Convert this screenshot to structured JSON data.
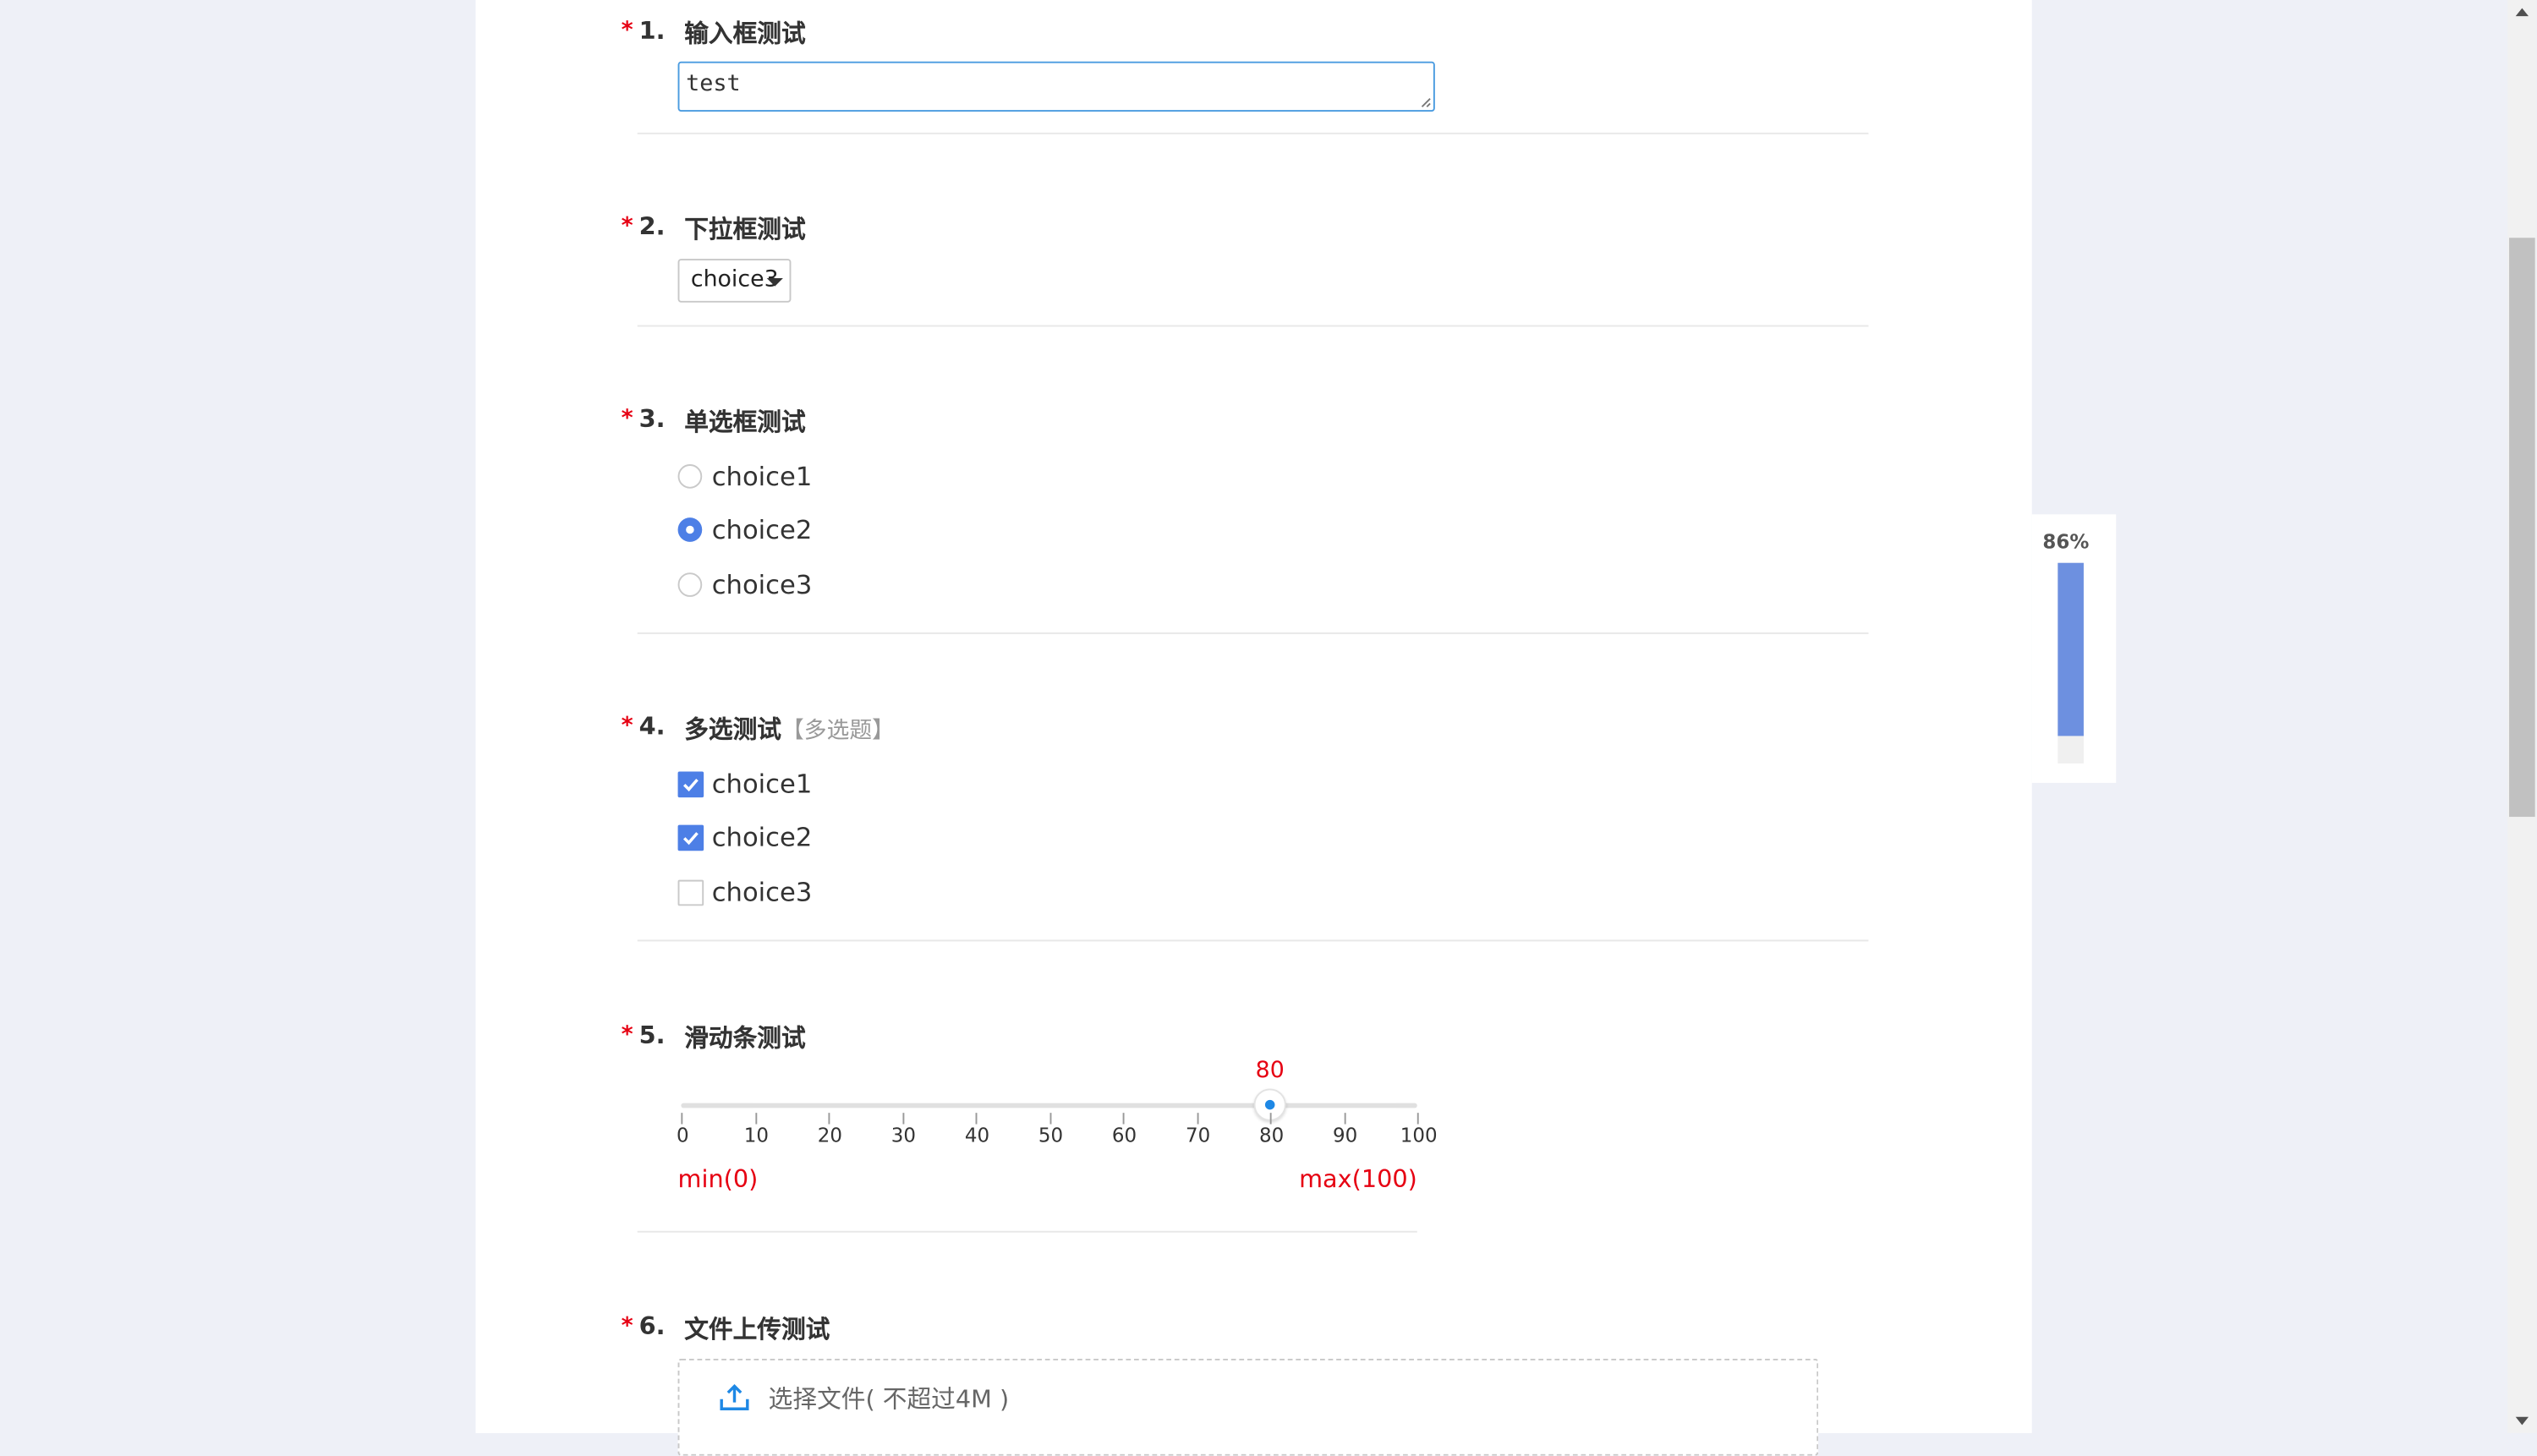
{
  "questions": [
    {
      "number": "1.",
      "required": "*",
      "title": "输入框测试",
      "type": "text",
      "value": "test"
    },
    {
      "number": "2.",
      "required": "*",
      "title": "下拉框测试",
      "type": "select",
      "selected": "choice3"
    },
    {
      "number": "3.",
      "required": "*",
      "title": "单选框测试",
      "type": "radio",
      "options": [
        {
          "label": "choice1",
          "checked": false
        },
        {
          "label": "choice2",
          "checked": true
        },
        {
          "label": "choice3",
          "checked": false
        }
      ]
    },
    {
      "number": "4.",
      "required": "*",
      "title": "多选测试",
      "note": "【多选题】",
      "type": "checkbox",
      "options": [
        {
          "label": "choice1",
          "checked": true
        },
        {
          "label": "choice2",
          "checked": true
        },
        {
          "label": "choice3",
          "checked": false
        }
      ]
    },
    {
      "number": "5.",
      "required": "*",
      "title": "滑动条测试",
      "type": "slider",
      "value": 80,
      "value_label": "80",
      "min": 0,
      "max": 100,
      "ticks": [
        "0",
        "10",
        "20",
        "30",
        "40",
        "50",
        "60",
        "70",
        "80",
        "90",
        "100"
      ],
      "min_label": "min(0)",
      "max_label": "max(100)"
    },
    {
      "number": "6.",
      "required": "*",
      "title": "文件上传测试",
      "type": "upload",
      "upload_text": "选择文件( 不超过4M )"
    }
  ],
  "progress": {
    "label": "86%",
    "value": 0.86
  },
  "colors": {
    "required": "#e60012",
    "accent": "#4d7fe6",
    "progress": "#6d90e0",
    "slider_dot": "#1e88e5",
    "input_focus": "#4a9be0"
  },
  "icons": {
    "upload": "upload-icon",
    "check": "checkmark-icon",
    "dropdown": "caret-down-icon"
  }
}
